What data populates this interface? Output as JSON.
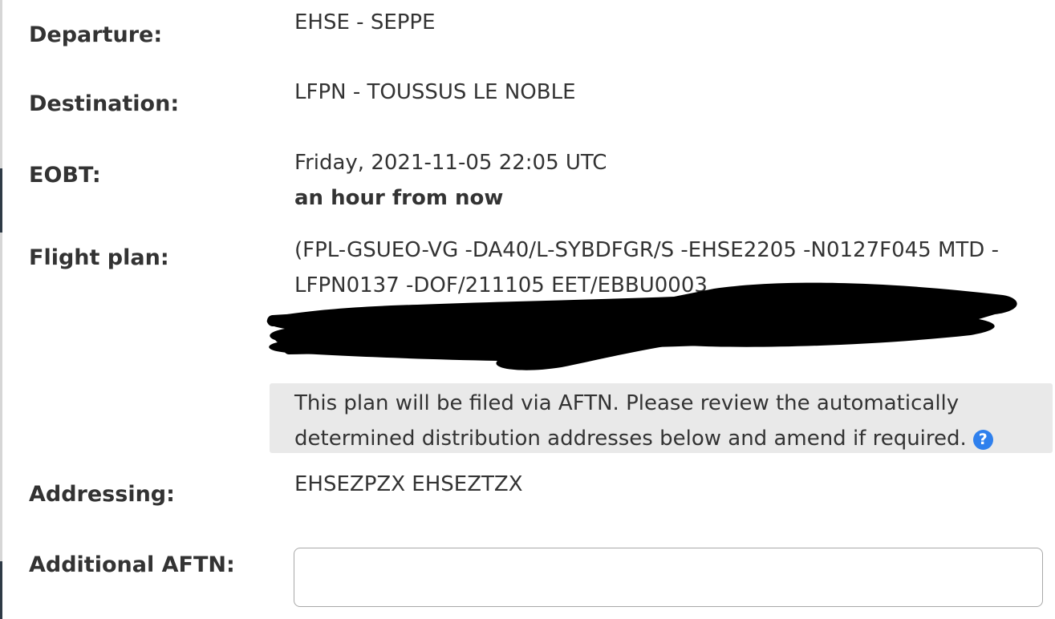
{
  "form": {
    "departure": {
      "label": "Departure:",
      "value": "EHSE - SEPPE"
    },
    "destination": {
      "label": "Destination:",
      "value": "LFPN - TOUSSUS LE NOBLE"
    },
    "eobt": {
      "label": "EOBT:",
      "value": "Friday, 2021-11-05 22:05 UTC",
      "relative": "an hour from now"
    },
    "flight_plan": {
      "label": "Flight plan:",
      "text": "(FPL-GSUEO-VG -DA40/L-SYBDFGR/S -EHSE2205 -N0127F045 MTD - LFPN0137 -DOF/211105 EET/EBBU0003"
    },
    "notice": {
      "text": "This plan will be filed via AFTN. Please review the automatically determined distribution addresses below and amend if required.",
      "help_icon": "question-circle-icon",
      "help_glyph": "?"
    },
    "addressing": {
      "label": "Addressing:",
      "value": "EHSEZPZX EHSEZTZX"
    },
    "additional_aftn": {
      "label": "Additional AFTN:",
      "value": "",
      "placeholder": ""
    }
  },
  "colors": {
    "text": "#333333",
    "notice_bg": "#e9e9e9",
    "help_icon": "#2f80ed",
    "input_border": "#a8a8a8",
    "redaction": "#000000"
  }
}
